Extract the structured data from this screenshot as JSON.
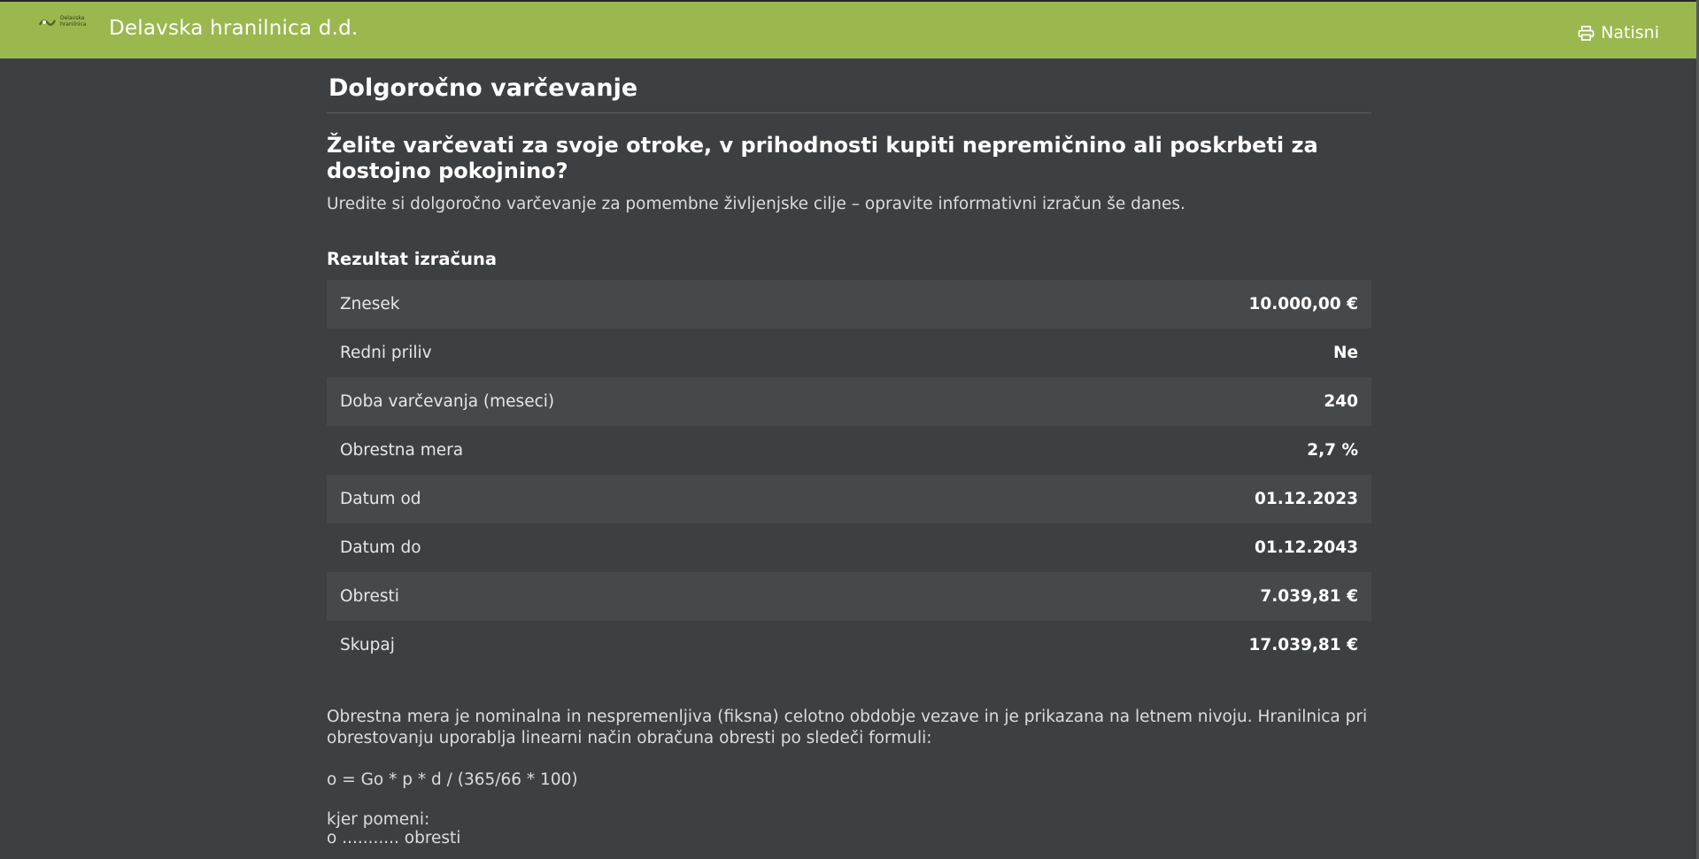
{
  "header": {
    "brand": "Delavska hranilnica d.d.",
    "logo_text_line1": "Delavska",
    "logo_text_line2": "hranilnica",
    "print_label": "Natisni",
    "print_icon": "print-icon",
    "accent_color": "#9ab84e"
  },
  "page": {
    "title": "Dolgoročno varčevanje",
    "lead_heading": "Želite varčevati za svoje otroke, v prihodnosti kupiti nepremičnino ali poskrbeti za dostojno pokojnino?",
    "lead_text": "Uredite si dolgoročno varčevanje za pomembne življenjske cilje – opravite informativni izračun še danes.",
    "result_title": "Rezultat izračuna"
  },
  "results": {
    "rows": [
      {
        "label": "Znesek",
        "value": "10.000,00 €"
      },
      {
        "label": "Redni priliv",
        "value": "Ne"
      },
      {
        "label": "Doba varčevanja (meseci)",
        "value": "240"
      },
      {
        "label": "Obrestna mera",
        "value": "2,7 %"
      },
      {
        "label": "Datum od",
        "value": "01.12.2023"
      },
      {
        "label": "Datum do",
        "value": "01.12.2043"
      },
      {
        "label": "Obresti",
        "value": "7.039,81 €"
      },
      {
        "label": "Skupaj",
        "value": "17.039,81 €"
      }
    ]
  },
  "notes": {
    "paragraph": "Obrestna mera je nominalna in nespremenljiva (fiksna) celotno obdobje vezave in je prikazana na letnem nivoju. Hranilnica pri obrestovanju uporablja linearni način obračuna obresti po sledeči formuli:",
    "formula": "o = Go * p * d / (365/66 * 100)",
    "legend_title": "kjer pomeni:",
    "legend_first": "o ........... obresti"
  }
}
